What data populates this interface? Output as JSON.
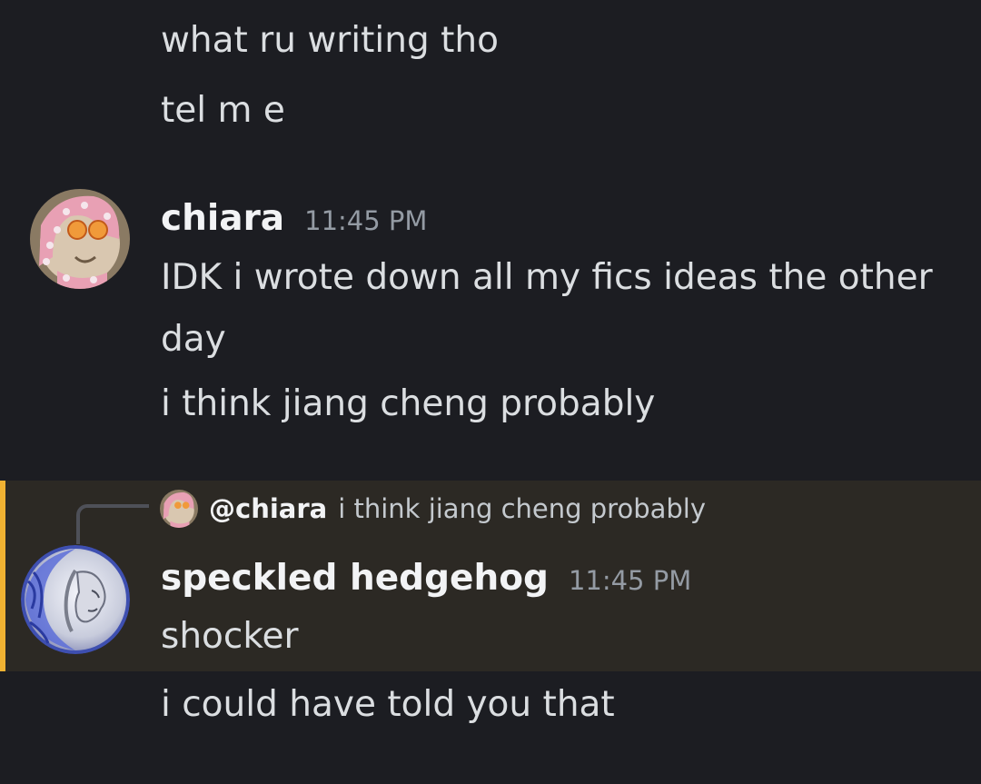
{
  "messages_top": {
    "line_1": "what ru writing tho",
    "line_2": "tel m e"
  },
  "chiara_message": {
    "username": "chiara",
    "timestamp": "11:45 PM",
    "avatar_icon": "cat-avatar-icon",
    "text_1": "IDK i wrote down all my fics ideas the other day",
    "text_2": "i think jiang cheng probably"
  },
  "reply": {
    "mention": "@chiara",
    "quoted_text": "i think jiang cheng probably",
    "avatar_icon": "cat-avatar-icon"
  },
  "hedgehog_message": {
    "username": "speckled hedgehog",
    "timestamp": "11:45 PM",
    "avatar_icon": "portrait-moon-avatar-icon",
    "text_1": "shocker",
    "text_2": "i could have told you that"
  },
  "colors": {
    "background": "#1c1d22",
    "highlight_background": "#2c2924",
    "highlight_bar": "#f0b232",
    "username": "#f2f3f5",
    "timestamp": "#949ba4",
    "message_text": "#dbdee1"
  }
}
